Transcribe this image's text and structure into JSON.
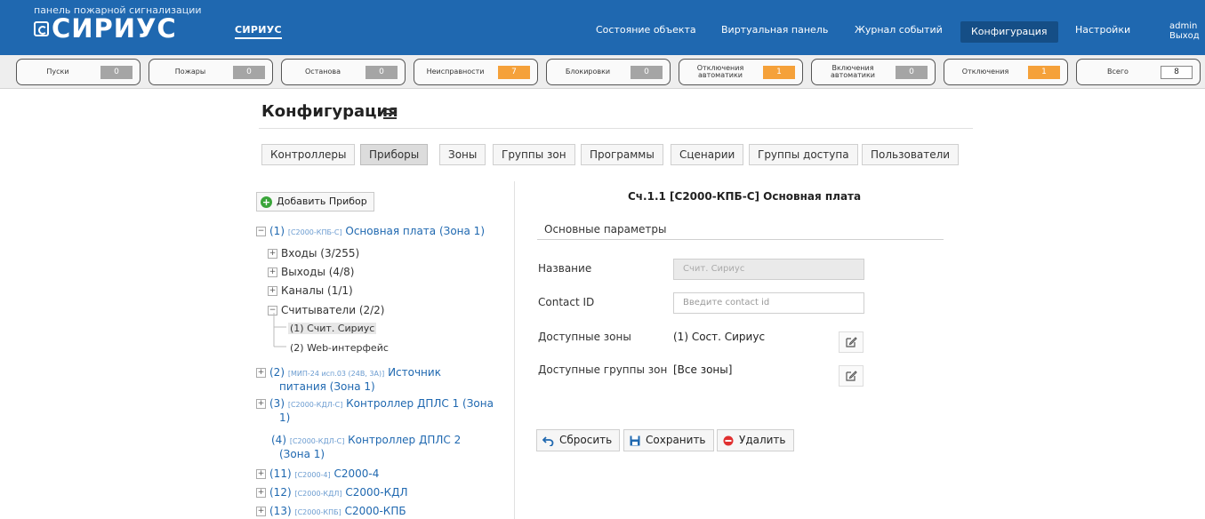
{
  "header": {
    "brand_subtitle": "панель пожарной сигнализации",
    "brand_name": "СИРИУС",
    "system_name": "СИРИУС",
    "nav": [
      {
        "label": "Состояние объекта"
      },
      {
        "label": "Виртуальная панель"
      },
      {
        "label": "Журнал событий"
      },
      {
        "label": "Конфигурация",
        "active": true
      },
      {
        "label": "Настройки"
      }
    ],
    "user": "admin",
    "logout": "Выход",
    "accent_color": "#1f68b0"
  },
  "counters": [
    {
      "label": "Пуски",
      "value": "0",
      "status": "normal"
    },
    {
      "label": "Пожары",
      "value": "0",
      "status": "normal"
    },
    {
      "label": "Останова",
      "value": "0",
      "status": "normal"
    },
    {
      "label": "Неисправности",
      "value": "7",
      "status": "warning"
    },
    {
      "label": "Блокировки",
      "value": "0",
      "status": "normal"
    },
    {
      "label": "Отключения автоматики",
      "value": "1",
      "status": "warning"
    },
    {
      "label": "Включения автоматики",
      "value": "0",
      "status": "normal"
    },
    {
      "label": "Отключения",
      "value": "1",
      "status": "warning"
    },
    {
      "label": "Всего",
      "value": "8",
      "status": "total"
    }
  ],
  "page": {
    "title": "Конфигурация",
    "menu_icon": "hamburger-icon"
  },
  "tabs": [
    {
      "label": "Контроллеры"
    },
    {
      "label": "Приборы",
      "active": true
    },
    {
      "label": "Зоны"
    },
    {
      "label": "Группы зон"
    },
    {
      "label": "Программы"
    },
    {
      "label": "Сценарии"
    },
    {
      "label": "Группы доступа"
    },
    {
      "label": "Пользователи"
    }
  ],
  "tree": {
    "add_button": "Добавить Прибор",
    "device1": {
      "num": "(1)",
      "type": "[C2000-КПБ-С]",
      "name": "Основная плата (Зона 1)"
    },
    "device1_children": [
      {
        "label": "Входы (3/255)"
      },
      {
        "label": "Выходы (4/8)"
      },
      {
        "label": "Каналы (1/1)"
      },
      {
        "label": "Считыватели (2/2)"
      }
    ],
    "readers": [
      {
        "label": "(1) Счит. Сириус",
        "selected": true
      },
      {
        "label": "(2) Web-интерфейс"
      }
    ],
    "device2": {
      "num": "(2)",
      "type": "[МИП-24 исп.03 (24В, 3А)]",
      "name": "Источник",
      "name2": "питания (Зона 1)"
    },
    "device3": {
      "num": "(3)",
      "type": "[C2000-КДЛ-С]",
      "name": "Контроллер ДПЛС 1 (Зона",
      "name2": "1)"
    },
    "device4": {
      "num": "(4)",
      "type": "[C2000-КДЛ-С]",
      "name": "Контроллер ДПЛС 2",
      "name2": "(Зона 1)"
    },
    "device11": {
      "num": "(11)",
      "type": "[C2000-4]",
      "name": "С2000-4"
    },
    "device12": {
      "num": "(12)",
      "type": "[C2000-КДЛ]",
      "name": "С2000-КДЛ"
    },
    "device13": {
      "num": "(13)",
      "type": "[C2000-КПБ]",
      "name": "С2000-КПБ"
    }
  },
  "detail": {
    "title": "Сч.1.1 [С2000-КПБ-С] Основная плата",
    "section": "Основные параметры",
    "fields": {
      "name_label": "Название",
      "name_value": "Счит. Сириус",
      "contact_label": "Contact ID",
      "contact_placeholder": "Введите contact id",
      "zones_label": "Доступные зоны",
      "zones_value": "(1) Сост. Сириус",
      "groups_label": "Доступные группы зон",
      "groups_value": "[Все зоны]"
    },
    "buttons": {
      "reset": "Сбросить",
      "save": "Сохранить",
      "delete": "Удалить"
    }
  }
}
